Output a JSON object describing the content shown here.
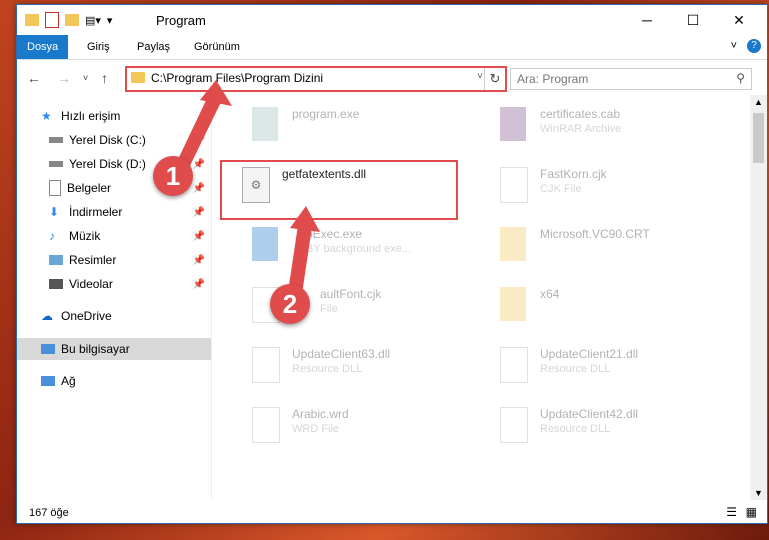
{
  "window": {
    "title": "Program"
  },
  "ribbon": {
    "tabs": [
      "Dosya",
      "Giriş",
      "Paylaş",
      "Görünüm"
    ]
  },
  "address": {
    "path": "C:\\Program Files\\Program Dizini"
  },
  "search": {
    "placeholder": "Ara: Program"
  },
  "nav": {
    "items": [
      "Hızlı erişim",
      "Yerel Disk (C:)",
      "Yerel Disk (D:)",
      "Belgeler",
      "İndirmeler",
      "Müzik",
      "Resimler",
      "Videolar",
      "OneDrive",
      "Bu bilgisayar",
      "Ağ"
    ]
  },
  "files": [
    {
      "name": "program.exe",
      "type": ""
    },
    {
      "name": "certificates.cab",
      "type": "WinRAR Archive"
    },
    {
      "name": "getfatextents.dll",
      "type": ""
    },
    {
      "name": "FastKorn.cjk",
      "type": "CJK File"
    },
    {
      "name": "pExec.exe",
      "type": "BY background exe..."
    },
    {
      "name": "Microsoft.VC90.CRT",
      "type": ""
    },
    {
      "name": "aultFont.cjk",
      "type": "File"
    },
    {
      "name": "x64",
      "type": ""
    },
    {
      "name": "UpdateClient63.dll",
      "type": "Resource DLL"
    },
    {
      "name": "UpdateClient21.dll",
      "type": "Resource DLL"
    },
    {
      "name": "Arabic.wrd",
      "type": "WRD File"
    },
    {
      "name": "UpdateClient42.dll",
      "type": "Resource DLL"
    }
  ],
  "status": {
    "count": "167 öğe"
  },
  "annotations": {
    "step1": "1",
    "step2": "2"
  },
  "colors": {
    "accent": "#1979ca",
    "highlight": "#e04b4b"
  }
}
